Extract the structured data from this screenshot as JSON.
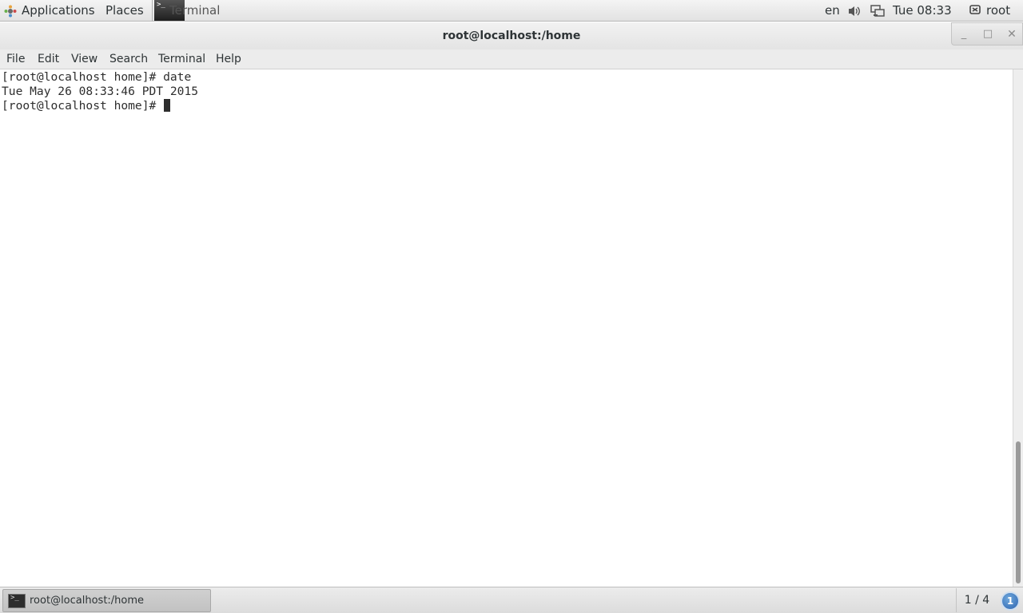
{
  "top_panel": {
    "applications_label": "Applications",
    "places_label": "Places",
    "active_app_label": "Terminal",
    "language": "en",
    "clock": "Tue 08:33",
    "user": "root",
    "icons": [
      "applications-icon",
      "terminal-icon",
      "volume-icon",
      "network-icon",
      "user-icon"
    ]
  },
  "window": {
    "title": "root@localhost:/home",
    "controls": {
      "minimize": "_",
      "maximize": "□",
      "close": "✕"
    }
  },
  "menu": {
    "items": [
      "File",
      "Edit",
      "View",
      "Search",
      "Terminal",
      "Help"
    ]
  },
  "terminal": {
    "lines": [
      "[root@localhost home]# date",
      "Tue May 26 08:33:46 PDT 2015",
      "[root@localhost home]# "
    ]
  },
  "bottom_panel": {
    "task_label": "root@localhost:/home",
    "workspace": "1 / 4",
    "notification_count": "1"
  },
  "colors": {
    "panel_bg": "#e8e8e8",
    "terminal_bg": "#ffffff",
    "terminal_fg": "#2e2e2e",
    "notification_blue": "#2d64b0"
  }
}
